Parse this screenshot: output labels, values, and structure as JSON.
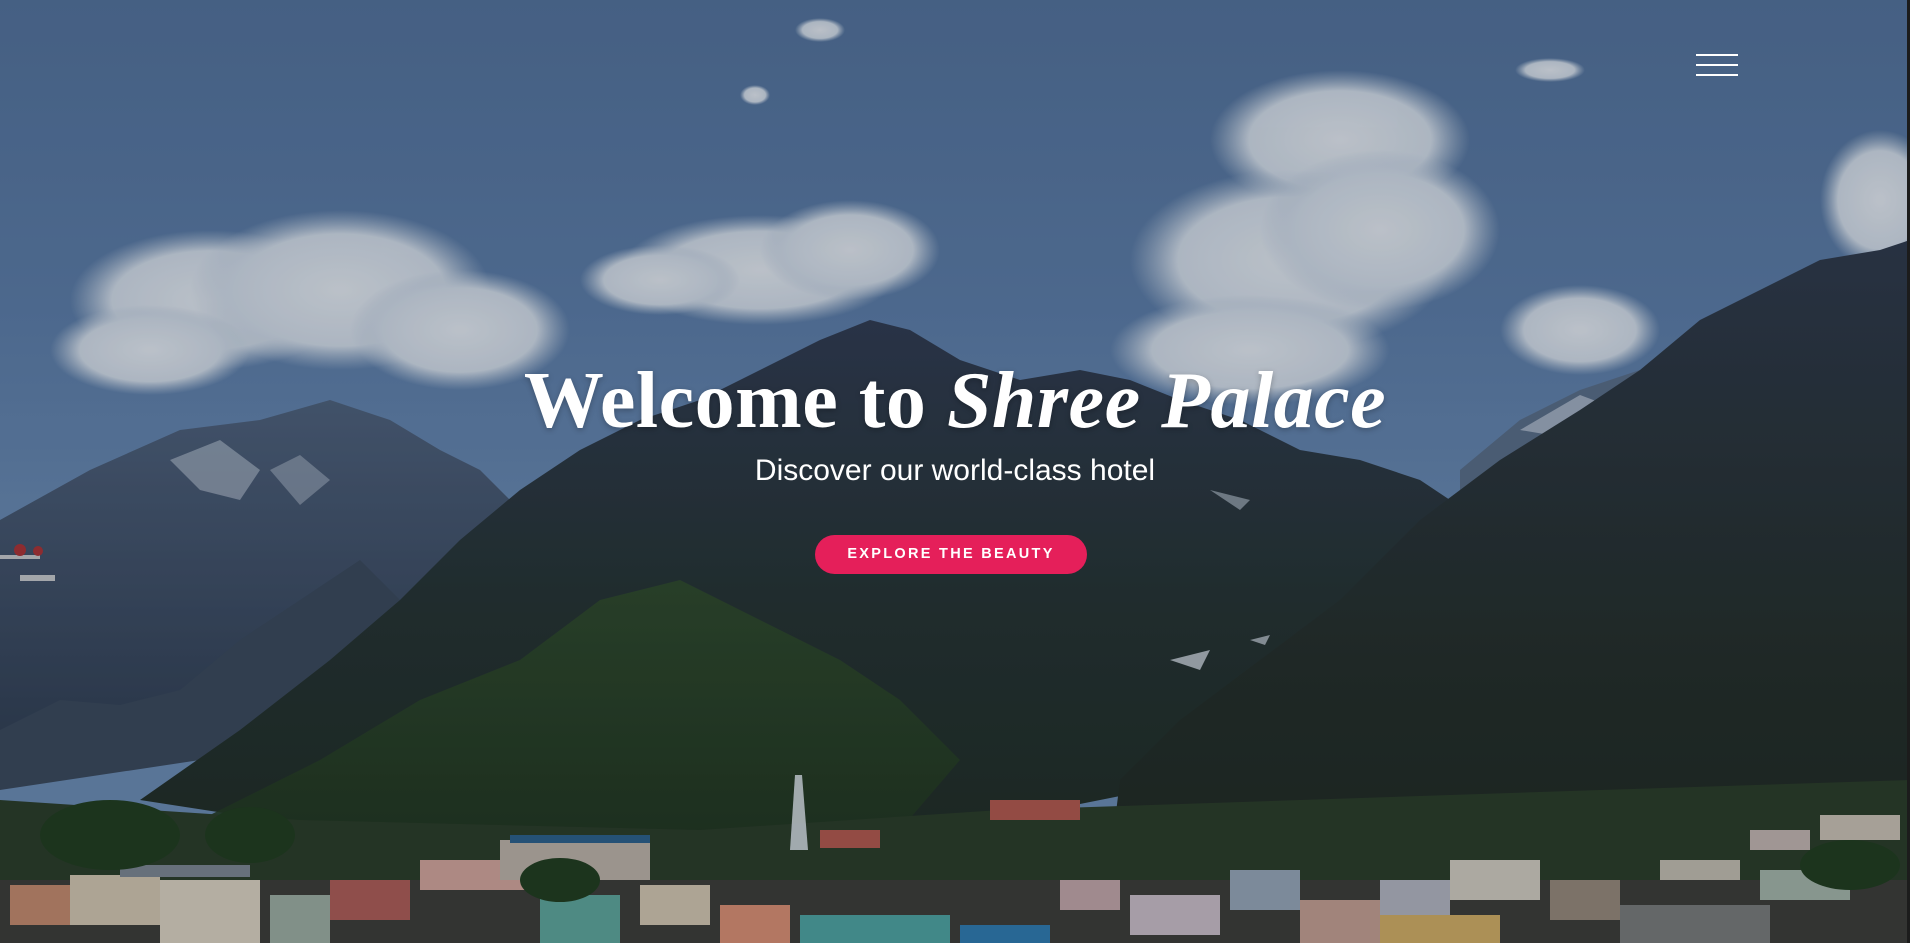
{
  "hero": {
    "title_prefix": "Welcome to",
    "title_accent": "Shree Palace",
    "subtitle": "Discover our world-class hotel",
    "cta_label": "EXPLORE THE BEAUTY"
  },
  "nav": {
    "menu_icon": "hamburger-menu-icon"
  },
  "colors": {
    "accent": "#e51f5a",
    "text": "#ffffff",
    "sky": "#5b7aa3"
  }
}
